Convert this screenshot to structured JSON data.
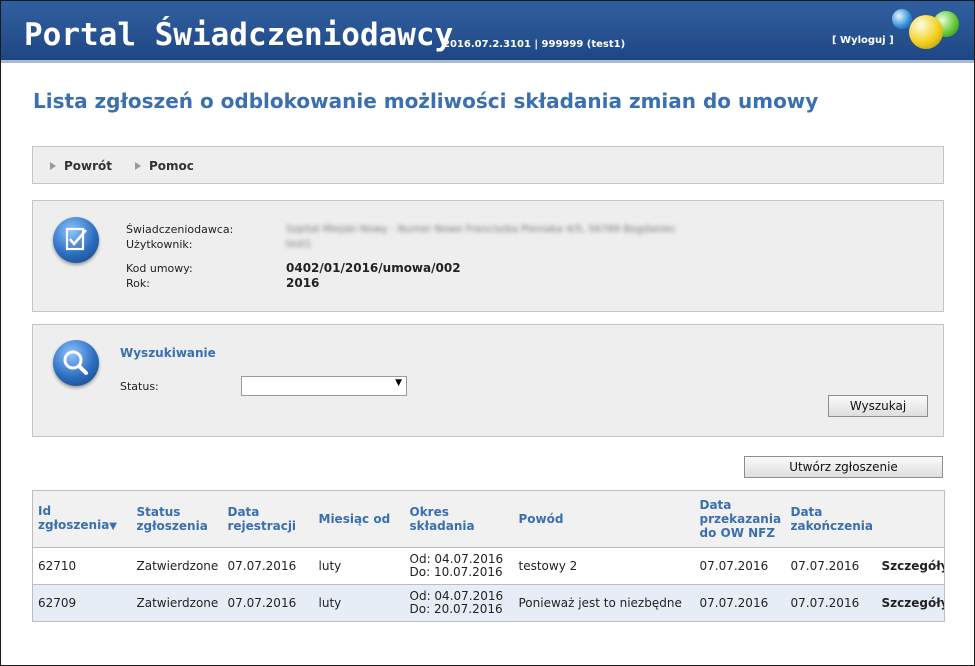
{
  "header": {
    "app_title": "Portal Świadczeniodawcy",
    "version_info": "2016.07.2.3101 | 999999 (test1)",
    "logout_label": "[ Wyloguj ]"
  },
  "page": {
    "title": "Lista zgłoszeń o odblokowanie możliwości składania zmian do umowy"
  },
  "nav": {
    "items": [
      {
        "label": "Powrót"
      },
      {
        "label": "Pomoc"
      }
    ]
  },
  "info": {
    "provider_label": "Świadczeniodawca:",
    "provider_value": "Szpital Miejski Nowy - Numer Nowe Franciszka Pieniaka 4/5, 56789 Bogdaniec",
    "user_label": "Użytkownik:",
    "user_value": "test1",
    "contract_label": "Kod umowy:",
    "contract_value": "0402/01/2016/umowa/002",
    "year_label": "Rok:",
    "year_value": "2016"
  },
  "search": {
    "heading": "Wyszukiwanie",
    "status_label": "Status:",
    "status_value": "",
    "search_button": "Wyszukaj"
  },
  "actions": {
    "create_button": "Utwórz zgłoszenie"
  },
  "table": {
    "columns": [
      {
        "label": "Id zgłoszenia",
        "sort_indicator": "▼"
      },
      {
        "label": "Status zgłoszenia"
      },
      {
        "label": "Data rejestracji"
      },
      {
        "label": "Miesiąc od"
      },
      {
        "label": "Okres składania"
      },
      {
        "label": "Powód"
      },
      {
        "label": "Data przekazania do OW NFZ"
      },
      {
        "label": "Data zakończenia"
      },
      {
        "label": ""
      }
    ],
    "rows": [
      {
        "id": "62710",
        "status": "Zatwierdzone",
        "registration_date": "07.07.2016",
        "month_from": "luty",
        "period_from": "Od: 04.07.2016",
        "period_to": "Do: 10.07.2016",
        "reason": "testowy 2",
        "transfer_date": "07.07.2016",
        "end_date": "07.07.2016",
        "details_label": "Szczegóły"
      },
      {
        "id": "62709",
        "status": "Zatwierdzone",
        "registration_date": "07.07.2016",
        "month_from": "luty",
        "period_from": "Od: 04.07.2016",
        "period_to": "Do: 20.07.2016",
        "reason": "Ponieważ jest to niezbędne",
        "transfer_date": "07.07.2016",
        "end_date": "07.07.2016",
        "details_label": "Szczegóły"
      }
    ]
  },
  "colors": {
    "header_blue": "#2a5594",
    "title_blue": "#3a6fb0",
    "panel_bg": "#eeeeee",
    "alt_row_bg": "#e7edf7"
  },
  "icons": {
    "info_icon": "checklist-icon",
    "search_icon": "magnifier-icon",
    "nav_bullet": "triangle-right-icon",
    "select_arrow": "dropdown-arrow-icon"
  }
}
